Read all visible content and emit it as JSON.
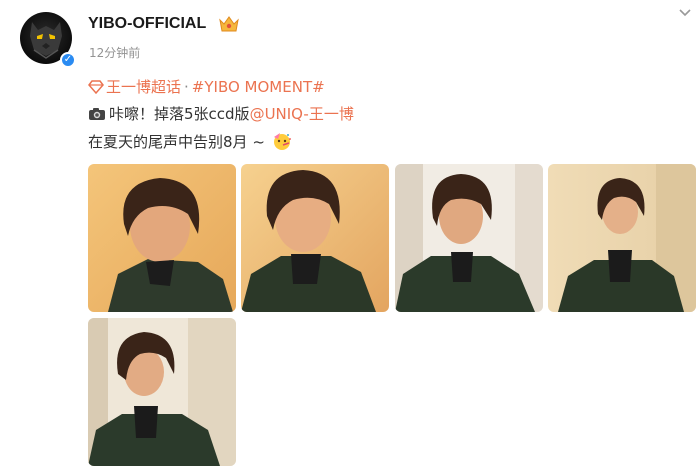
{
  "post": {
    "username": "YIBO-OFFICIAL",
    "timestamp": "12分钟前",
    "topic1": "王一博超话",
    "separator": "·",
    "topic2": "#YIBO MOMENT#",
    "line2_text": "咔嚓！掉落5张ccd版",
    "mention": "@UNIQ-王一博",
    "line3_text": "在夏天的尾声中告别8月 ~"
  },
  "photos": [
    {
      "name": "photo-1"
    },
    {
      "name": "photo-2"
    },
    {
      "name": "photo-3"
    },
    {
      "name": "photo-4"
    },
    {
      "name": "photo-5"
    }
  ],
  "colors": {
    "accent": "#eb7350",
    "verified": "#2a8bf2",
    "timestamp": "#939393"
  },
  "icons": [
    "crown-badge-icon",
    "chevron-down-icon",
    "diamond-icon",
    "camera-icon",
    "party-face-emoji-icon",
    "verified-icon"
  ]
}
